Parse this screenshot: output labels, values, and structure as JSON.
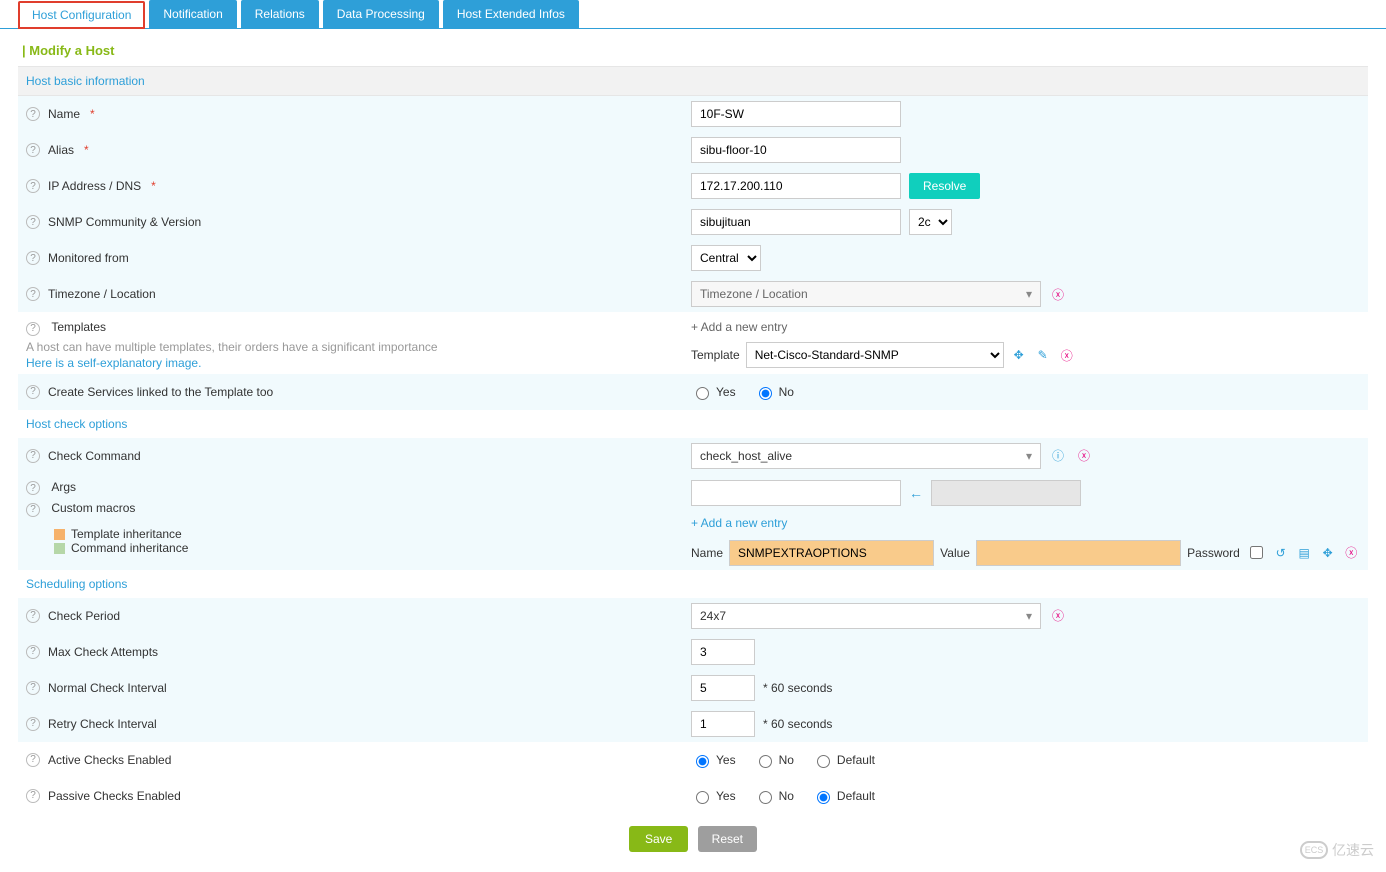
{
  "tabs": [
    "Host Configuration",
    "Notification",
    "Relations",
    "Data Processing",
    "Host Extended Infos"
  ],
  "page_title": "| Modify a Host",
  "sections": {
    "basic": "Host basic information",
    "check": "Host check options",
    "sched": "Scheduling options"
  },
  "labels": {
    "name": "Name",
    "alias": "Alias",
    "ip": "IP Address / DNS",
    "snmp": "SNMP Community & Version",
    "monitored": "Monitored from",
    "tz": "Timezone / Location",
    "templates": "Templates",
    "templates_note": "A host can have multiple templates, their orders have a significant importance",
    "templates_link": "Here is a self-explanatory image.",
    "create_services": "Create Services linked to the Template too",
    "check_cmd": "Check Command",
    "args": "Args",
    "custom_macros": "Custom macros",
    "legend_tpl": "Template inheritance",
    "legend_cmd": "Command inheritance",
    "check_period": "Check Period",
    "max_attempts": "Max Check Attempts",
    "normal_interval": "Normal Check Interval",
    "retry_interval": "Retry Check Interval",
    "active_checks": "Active Checks Enabled",
    "passive_checks": "Passive Checks Enabled",
    "seconds": "* 60 seconds",
    "add_entry": "+ Add a new entry",
    "template": "Template",
    "macro_name": "Name",
    "macro_value": "Value",
    "macro_pass": "Password",
    "yes": "Yes",
    "no": "No",
    "default": "Default",
    "resolve": "Resolve",
    "save": "Save",
    "reset": "Reset",
    "tz_placeholder": "Timezone / Location"
  },
  "values": {
    "name": "10F-SW",
    "alias": "sibu-floor-10",
    "ip": "172.17.200.110",
    "snmp_community": "sibujituan",
    "snmp_version": "2c",
    "monitored": "Central",
    "template_select": "Net-Cisco-Standard-SNMP",
    "create_services": "No",
    "check_cmd": "check_host_alive",
    "macro_name": "SNMPEXTRAOPTIONS",
    "macro_value": "",
    "check_period": "24x7",
    "max_attempts": "3",
    "normal_interval": "5",
    "retry_interval": "1",
    "active_checks": "Yes",
    "passive_checks": "Default"
  },
  "watermark": "亿速云"
}
